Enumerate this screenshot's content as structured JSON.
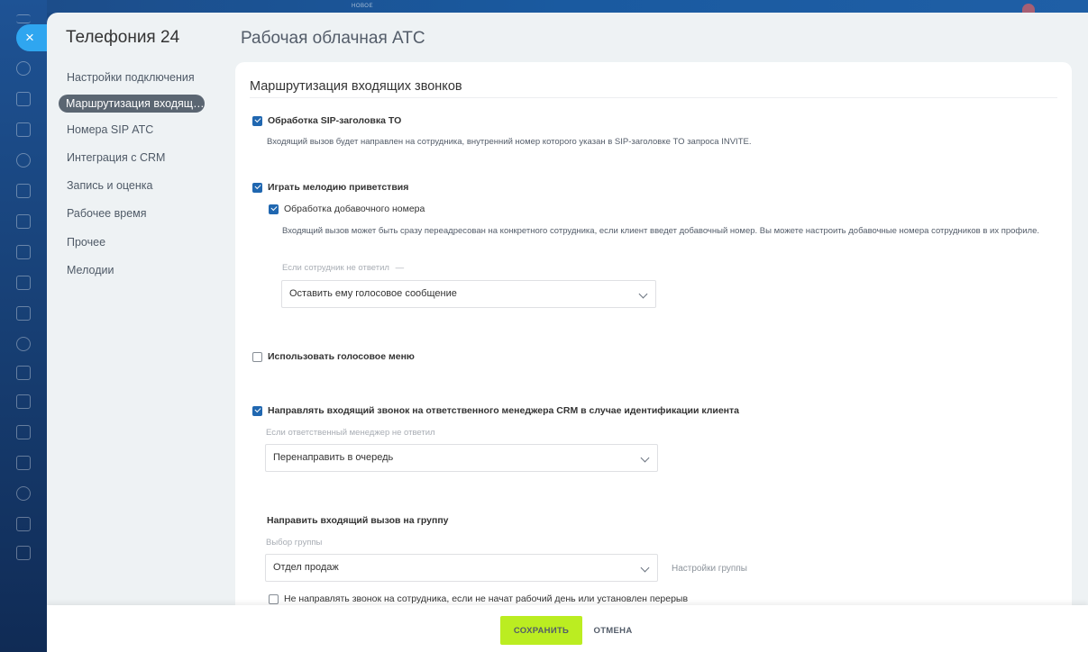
{
  "window": {
    "app_title": "Телефония 24",
    "page_title": "Рабочая облачная АТС",
    "close_symbol": "×",
    "top_label": "НОВОЕ"
  },
  "sidebar": {
    "items": [
      {
        "label": "Настройки подключения",
        "active": false
      },
      {
        "label": "Маршрутизация входящих звонков",
        "active": true
      },
      {
        "label": "Номера SIP АТС",
        "active": false
      },
      {
        "label": "Интеграция с CRM",
        "active": false
      },
      {
        "label": "Запись и оценка",
        "active": false
      },
      {
        "label": "Рабочее время",
        "active": false
      },
      {
        "label": "Прочее",
        "active": false
      },
      {
        "label": "Мелодии",
        "active": false
      }
    ]
  },
  "main": {
    "section_title": "Маршрутизация входящих звонков",
    "sip_header": {
      "checked": true,
      "label": "Обработка SIP-заголовка TO",
      "hint": "Входящий вызов будет направлен на сотрудника, внутренний номер которого указан в SIP-заголовке TO запроса INVITE."
    },
    "greeting": {
      "checked": true,
      "label": "Играть мелодию приветствия"
    },
    "extension": {
      "checked": true,
      "label": "Обработка добавочного номера",
      "hint": "Входящий вызов может быть сразу переадресован на конкретного сотрудника, если клиент введет добавочный номер. Вы можете настроить добавочные номера сотрудников в их профиле.",
      "no_answer_label": "Если сотрудник не ответил",
      "no_answer_dash": "—",
      "no_answer_value": "Оставить ему голосовое сообщение"
    },
    "ivr": {
      "checked": false,
      "label": "Использовать голосовое меню"
    },
    "crm_manager": {
      "checked": true,
      "label": "Направлять входящий звонок на ответственного менеджера CRM в случае идентификации клиента",
      "no_answer_label": "Если ответственный менеджер не ответил",
      "no_answer_value": "Перенаправить в очередь"
    },
    "group": {
      "title": "Направить входящий вызов на группу",
      "select_label": "Выбор группы",
      "select_value": "Отдел продаж",
      "settings_link": "Настройки группы",
      "skip_checkbox_checked": false,
      "skip_label": "Не направлять звонок на сотрудника, если не начат рабочий день или установлен перерыв"
    }
  },
  "footer": {
    "save_label": "СОХРАНИТЬ",
    "cancel_label": "ОТМЕНА"
  },
  "colors": {
    "accent": "#2067b0",
    "save": "#bbed21",
    "close": "#2fa6f0",
    "active_menu": "#5b6672"
  }
}
